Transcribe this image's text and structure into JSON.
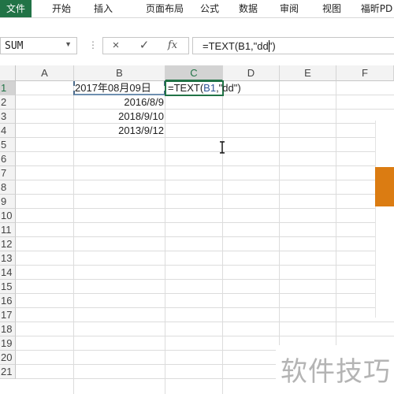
{
  "ribbon": {
    "tabs": [
      {
        "label": "文件",
        "active": true
      },
      {
        "label": "开始",
        "active": false
      },
      {
        "label": "插入",
        "active": false
      },
      {
        "label": "页面布局",
        "active": false
      },
      {
        "label": "公式",
        "active": false
      },
      {
        "label": "数据",
        "active": false
      },
      {
        "label": "审阅",
        "active": false
      },
      {
        "label": "视图",
        "active": false
      },
      {
        "label": "福昕PD",
        "active": false
      }
    ]
  },
  "formula_bar": {
    "name_box": "SUM",
    "cancel_icon": "×",
    "enter_icon": "✓",
    "fx_label": "fx",
    "formula": "=TEXT(B1,\"dd\")"
  },
  "grid": {
    "columns": [
      "A",
      "B",
      "C",
      "D",
      "E",
      "F"
    ],
    "rows": [
      "1",
      "2",
      "3",
      "4",
      "5",
      "6",
      "7",
      "8",
      "9",
      "10",
      "11",
      "12",
      "13",
      "14",
      "15",
      "16",
      "17",
      "18",
      "19",
      "20",
      "21"
    ],
    "selected_column": "C",
    "selected_row": "1",
    "cells": {
      "B1": "2017年08月09日",
      "B2": "2016/8/9",
      "B3": "2018/9/10",
      "B4": "2013/9/12",
      "C1_prefix": "=TEXT(",
      "C1_ref": "B1",
      "C1_suffix": ",\"dd\")"
    }
  },
  "watermark": "软件技巧",
  "colors": {
    "accent": "#217346",
    "reference": "#2f5597",
    "overlay_orange": "#db7c12"
  }
}
